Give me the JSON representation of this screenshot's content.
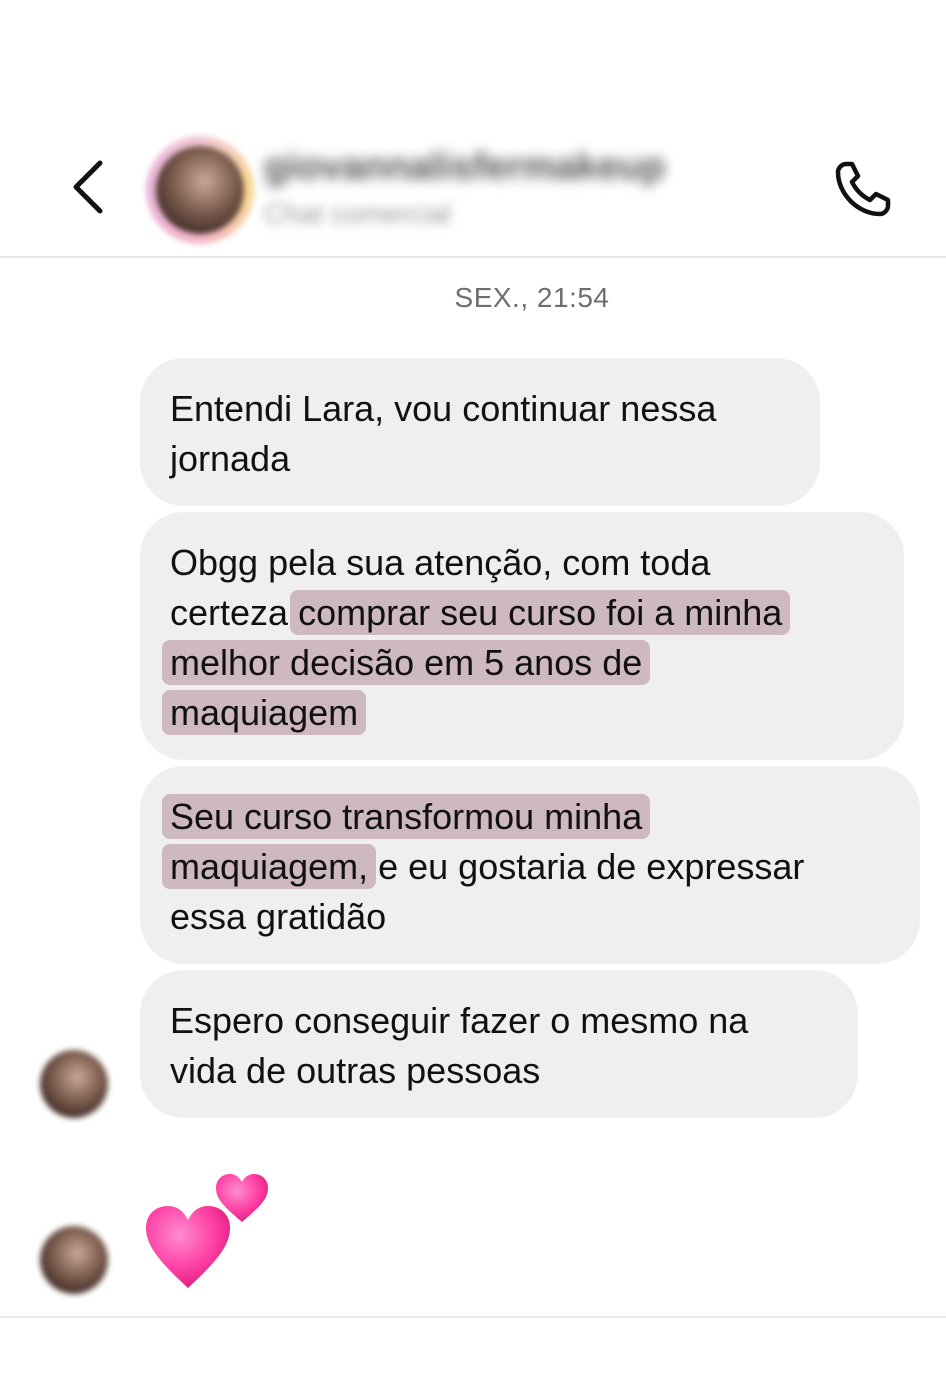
{
  "header": {
    "username": "giovannalisfermakeup",
    "subtitle": "Chat comercial",
    "back_icon": "chevron-left-icon",
    "call_icon": "phone-icon"
  },
  "thread": {
    "timestamp": "SEX., 21:54",
    "messages": [
      {
        "lines": [
          "Entendi Lara, vou continuar nessa",
          "jornada"
        ]
      },
      {
        "lines": [
          "Obgg pela sua atenção, com toda",
          "certeza ",
          "comprar seu curso foi a minha",
          "melhor decisão em 5 anos de",
          "maquiagem"
        ]
      },
      {
        "lines": [
          "Seu curso transformou minha",
          "maquiagem,",
          " e eu gostaria de expressar",
          "essa gratidão"
        ]
      },
      {
        "lines": [
          "Espero conseguir fazer o mesmo na",
          "vida de outras pessoas"
        ]
      }
    ],
    "reaction": {
      "icon": "two-hearts-icon",
      "glyph": "💕"
    }
  },
  "colors": {
    "bubble_bg": "#efefef",
    "highlight": "#a06e82",
    "heart_pink": "#ff3fa4"
  }
}
